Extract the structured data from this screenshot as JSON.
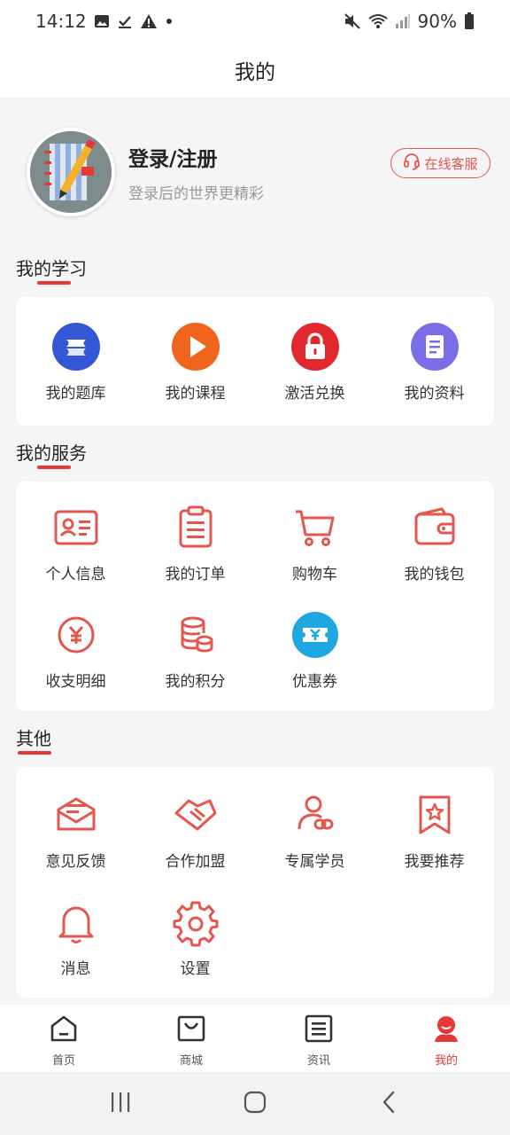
{
  "status": {
    "time": "14:12",
    "battery": "90%"
  },
  "header": {
    "title": "我的"
  },
  "profile": {
    "login_title": "登录/注册",
    "login_subtitle": "登录后的世界更精彩",
    "service_button": "在线客服"
  },
  "sections": {
    "study": {
      "title": "我的学习",
      "items": [
        "我的题库",
        "我的课程",
        "激活兑换",
        "我的资料"
      ]
    },
    "service": {
      "title": "我的服务",
      "items": [
        "个人信息",
        "我的订单",
        "购物车",
        "我的钱包",
        "收支明细",
        "我的积分",
        "优惠券"
      ]
    },
    "other": {
      "title": "其他",
      "items": [
        "意见反馈",
        "合作加盟",
        "专属学员",
        "我要推荐",
        "消息",
        "设置"
      ]
    }
  },
  "bottom_nav": {
    "items": [
      "首页",
      "商城",
      "资讯",
      "我的"
    ],
    "active": "我的"
  },
  "colors": {
    "accent": "#e53935",
    "icon_red": "#e4574f",
    "bg": "#f5f5f5"
  }
}
